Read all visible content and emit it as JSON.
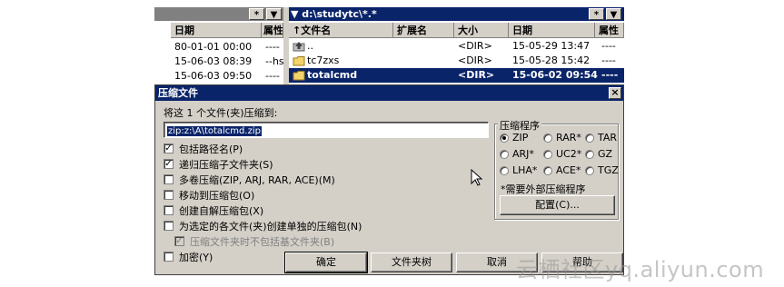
{
  "left_panel": {
    "headers": {
      "date": "日期",
      "attr": "属性"
    },
    "rows": [
      {
        "date": "80-01-01 00:00",
        "attr": "----"
      },
      {
        "date": "15-06-03 08:39",
        "attr": "--hs"
      },
      {
        "date": "15-06-03 09:50",
        "attr": "----"
      }
    ],
    "star_btn": "*",
    "dropdown_btn": "▼"
  },
  "right_panel": {
    "path": "▼ d:\\studytc\\*.*",
    "star_btn": "*",
    "dropdown_btn": "▼",
    "headers": {
      "name": "↑文件名",
      "ext": "扩展名",
      "size": "大小",
      "date": "日期",
      "attr": "属性"
    },
    "rows": [
      {
        "icon": "up-folder-icon",
        "name": "..",
        "ext": "",
        "size": "<DIR>",
        "date": "15-05-29 13:47",
        "attr": "----",
        "selected": false
      },
      {
        "icon": "folder-icon",
        "name": "tc7zxs",
        "ext": "",
        "size": "<DIR>",
        "date": "15-05-28 15:42",
        "attr": "----",
        "selected": false
      },
      {
        "icon": "folder-icon",
        "name": "totalcmd",
        "ext": "",
        "size": "<DIR>",
        "date": "15-06-02 09:54",
        "attr": "----",
        "selected": true
      }
    ]
  },
  "dialog": {
    "title": "压缩文件",
    "close_label": "×",
    "prompt": "将这 1 个文件(夹)压缩到:",
    "target_path": "zip:z:\\A\\totalcmd.zip",
    "options": [
      {
        "label": "包括路径名(P)",
        "checked": true,
        "disabled": false
      },
      {
        "label": "递归压缩子文件夹(S)",
        "checked": true,
        "disabled": false
      },
      {
        "label": "多卷压缩(ZIP, ARJ, RAR, ACE)(M)",
        "checked": false,
        "disabled": false
      },
      {
        "label": "移动到压缩包(O)",
        "checked": false,
        "disabled": false
      },
      {
        "label": "创建自解压缩包(X)",
        "checked": false,
        "disabled": false
      },
      {
        "label": "为选定的各文件(夹)创建单独的压缩包(N)",
        "checked": false,
        "disabled": false
      },
      {
        "label": "压缩文件夹时不包括基文件夹(B)",
        "checked": true,
        "disabled": true
      },
      {
        "label": "加密(Y)",
        "checked": false,
        "disabled": false
      }
    ],
    "packer_group": {
      "title": "压缩程序",
      "choices": [
        {
          "label": "ZIP",
          "selected": true
        },
        {
          "label": "RAR*",
          "selected": false
        },
        {
          "label": "TAR",
          "selected": false
        },
        {
          "label": "ARJ*",
          "selected": false
        },
        {
          "label": "UC2*",
          "selected": false
        },
        {
          "label": "GZ",
          "selected": false
        },
        {
          "label": "LHA*",
          "selected": false
        },
        {
          "label": "ACE*",
          "selected": false
        },
        {
          "label": "TGZ",
          "selected": false
        }
      ],
      "note": "*需要外部压缩程序",
      "config_button": "配置(C)..."
    },
    "buttons": {
      "ok": "确定",
      "folder": "文件夹树",
      "cancel": "取消",
      "help": "帮助"
    }
  },
  "watermark": "云栖社区yq.aliyun.com"
}
